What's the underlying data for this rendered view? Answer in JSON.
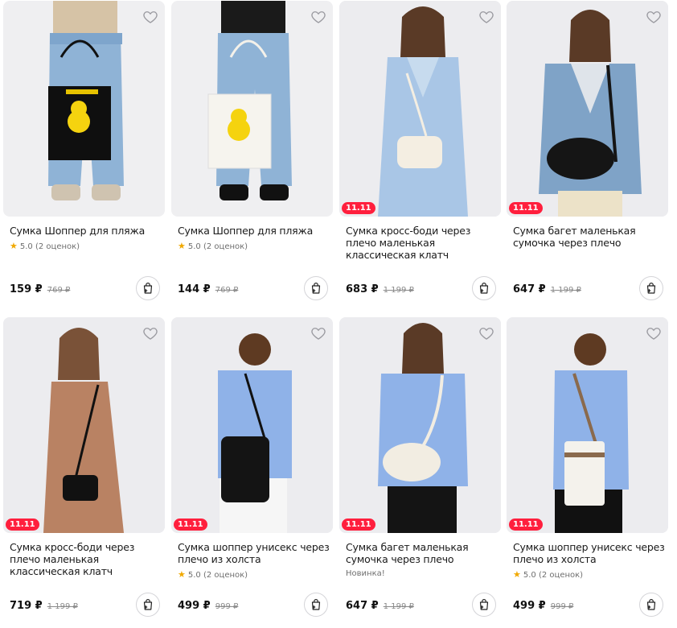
{
  "colors": {
    "badge": "#ff1f3d",
    "star": "#f0a800",
    "photo_bg": "#efeff1"
  },
  "icons": {
    "favorite": "heart-outline-icon",
    "cart": "shopping-bag-plus-icon",
    "rating": "star-icon"
  },
  "products": [
    {
      "title": "Сумка Шоппер для пляжа",
      "badge": "",
      "rating_star": "★",
      "rating": "5.0",
      "reviews": "(2 оценок)",
      "note": "",
      "price": "159 ₽",
      "old_price": "769 ₽"
    },
    {
      "title": "Сумка Шоппер для пляжа",
      "badge": "",
      "rating_star": "★",
      "rating": "5.0",
      "reviews": "(2 оценок)",
      "note": "",
      "price": "144 ₽",
      "old_price": "769 ₽"
    },
    {
      "title": "Сумка кросс-боди через плечо маленькая классическая клатч",
      "badge": "11.11",
      "rating_star": "",
      "rating": "",
      "reviews": "",
      "note": "",
      "price": "683 ₽",
      "old_price": "1 199 ₽"
    },
    {
      "title": "Сумка багет маленькая сумочка через плечо",
      "badge": "11.11",
      "rating_star": "",
      "rating": "",
      "reviews": "",
      "note": "",
      "price": "647 ₽",
      "old_price": "1 199 ₽"
    },
    {
      "title": "Сумка кросс-боди через плечо маленькая классическая клатч",
      "badge": "11.11",
      "rating_star": "",
      "rating": "",
      "reviews": "",
      "note": "",
      "price": "719 ₽",
      "old_price": "1 199 ₽"
    },
    {
      "title": "Сумка шоппер унисекс через плечо из холста",
      "badge": "11.11",
      "rating_star": "★",
      "rating": "5.0",
      "reviews": "(2 оценок)",
      "note": "",
      "price": "499 ₽",
      "old_price": "999 ₽"
    },
    {
      "title": "Сумка багет маленькая сумочка через плечо",
      "badge": "11.11",
      "rating_star": "",
      "rating": "",
      "reviews": "",
      "note": "Новинка!",
      "price": "647 ₽",
      "old_price": "1 199 ₽"
    },
    {
      "title": "Сумка шоппер унисекс через плечо из холста",
      "badge": "11.11",
      "rating_star": "★",
      "rating": "5.0",
      "reviews": "(2 оценок)",
      "note": "",
      "price": "499 ₽",
      "old_price": "999 ₽"
    }
  ]
}
